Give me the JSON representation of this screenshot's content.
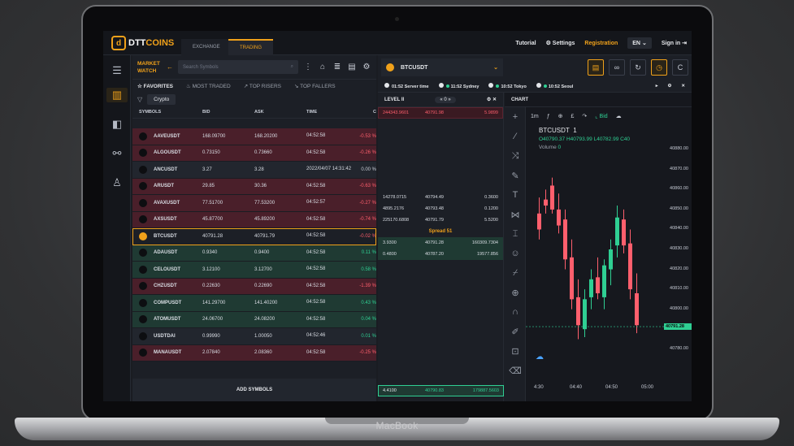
{
  "device": {
    "brand": "MacBook"
  },
  "header": {
    "logo": {
      "mark": "d",
      "name_bold": "DTT",
      "name_accent": "COINS"
    },
    "tabs": [
      {
        "label": "EXCHANGE"
      },
      {
        "label": "TRADING"
      }
    ],
    "active_tab": "TRADING",
    "links": {
      "tutorial": "Tutorial",
      "settings": "Settings",
      "registration": "Registration",
      "language": "EN",
      "signin": "Sign in"
    }
  },
  "market_watch": {
    "title": "MARKET WATCH",
    "search_placeholder": "Search Symbols",
    "filters": [
      "FAVORITES",
      "MOST TRADED",
      "TOP RISERS",
      "TOP FALLERS"
    ],
    "active_filter": "FAVORITES",
    "chip": "Crypto",
    "columns": [
      "SYMBOLS",
      "BID",
      "ASK",
      "TIME",
      "C"
    ],
    "rows": [
      {
        "symbol": "AAVEUSDT",
        "bid": "168.09700",
        "ask": "168.20200",
        "time": "04:52:58",
        "change": "-0.53 %",
        "trend": "dn"
      },
      {
        "symbol": "ALGOUSDT",
        "bid": "0.73150",
        "ask": "0.73660",
        "time": "04:52:58",
        "change": "-0.26 %",
        "trend": "dn"
      },
      {
        "symbol": "ANCUSDT",
        "bid": "3.27",
        "ask": "3.28",
        "time": "2022/04/07 14:31:42",
        "change": "0.00 %",
        "trend": "neutral"
      },
      {
        "symbol": "ARUSDT",
        "bid": "29.85",
        "ask": "30.36",
        "time": "04:52:58",
        "change": "-0.63 %",
        "trend": "dn"
      },
      {
        "symbol": "AVAXUSDT",
        "bid": "77.51700",
        "ask": "77.53200",
        "time": "04:52:57",
        "change": "-0.27 %",
        "trend": "dn"
      },
      {
        "symbol": "AXSUSDT",
        "bid": "45.87700",
        "ask": "45.89200",
        "time": "04:52:58",
        "change": "-0.74 %",
        "trend": "dn"
      },
      {
        "symbol": "BTCUSDT",
        "bid": "40791.28",
        "ask": "40791.79",
        "time": "04:52:58",
        "change": "-0.02 %",
        "trend": "sel"
      },
      {
        "symbol": "ADAUSDT",
        "bid": "0.9340",
        "ask": "0.9400",
        "time": "04:52:58",
        "change": "0.11 %",
        "trend": "up"
      },
      {
        "symbol": "CELOUSDT",
        "bid": "3.12100",
        "ask": "3.12700",
        "time": "04:52:58",
        "change": "0.58 %",
        "trend": "up"
      },
      {
        "symbol": "CHZUSDT",
        "bid": "0.22630",
        "ask": "0.22690",
        "time": "04:52:58",
        "change": "-1.39 %",
        "trend": "dn"
      },
      {
        "symbol": "COMPUSDT",
        "bid": "141.29700",
        "ask": "141.40200",
        "time": "04:52:58",
        "change": "0.43 %",
        "trend": "up"
      },
      {
        "symbol": "ATOMUSDT",
        "bid": "24.06700",
        "ask": "24.08200",
        "time": "04:52:58",
        "change": "0.04 %",
        "trend": "up"
      },
      {
        "symbol": "USDTDAI",
        "bid": "0.99990",
        "ask": "1.00050",
        "time": "04:52:46",
        "change": "0.01 %",
        "trend": "neutral"
      },
      {
        "symbol": "MANAUSDT",
        "bid": "2.07840",
        "ask": "2.08360",
        "time": "04:52:58",
        "change": "-0.25 %",
        "trend": "dn"
      }
    ],
    "add_symbols": "ADD SYMBOLS"
  },
  "instrument": {
    "symbol": "BTCUSDT"
  },
  "clocks": [
    {
      "time": "01:52",
      "label": "Server time"
    },
    {
      "time": "11:52",
      "label": "Sydney"
    },
    {
      "time": "10:52",
      "label": "Tokyo"
    },
    {
      "time": "10:52",
      "label": "Seoul"
    }
  ],
  "orderbook": {
    "title": "LEVEL II",
    "depth": "0",
    "top_ask": {
      "qty": "244343.9601",
      "price": "40791.98",
      "size": "5.9899"
    },
    "asks": [
      {
        "qty": "14278.0715",
        "price": "40794.49",
        "size": "0.3600"
      },
      {
        "qty": "4895.2176",
        "price": "40793.48",
        "size": "0.1200"
      },
      {
        "qty": "225170.6808",
        "price": "40791.79",
        "size": "5.5200"
      }
    ],
    "spread": "Spread 51",
    "bids": [
      {
        "qty": "3.9300",
        "price": "40791.28",
        "size": "160309.7304"
      },
      {
        "qty": "0.4800",
        "price": "40787.20",
        "size": "19577.856"
      }
    ],
    "last": {
      "qty": "4.4100",
      "price": "40790.83",
      "size": "179887.5603"
    }
  },
  "chart_panel": {
    "title": "CHART",
    "interval": "1m",
    "indicator": "Bid",
    "legend_symbol": "BTCUSDT",
    "legend_interval": "1",
    "ohlc": "O40790.37 H40793.99 L40782.99 C40",
    "volume_label": "Volume",
    "volume_value": "0"
  },
  "chart_data": {
    "type": "candlestick",
    "price_ticks": [
      "40880.00",
      "40870.00",
      "40860.00",
      "40850.00",
      "40840.00",
      "40830.00",
      "40820.00",
      "40810.00",
      "40800.00",
      "40791.28",
      "40780.00"
    ],
    "current_price": "40791.28",
    "time_ticks": [
      "4:30",
      "04:40",
      "04:50",
      "05:00"
    ],
    "ylim": [
      40775,
      40885
    ],
    "candles": [
      {
        "o": 40848,
        "h": 40856,
        "l": 40835,
        "c": 40840
      },
      {
        "o": 40855,
        "h": 40860,
        "l": 40848,
        "c": 40852
      },
      {
        "o": 40862,
        "h": 40866,
        "l": 40848,
        "c": 40850
      },
      {
        "o": 40850,
        "h": 40858,
        "l": 40838,
        "c": 40842
      },
      {
        "o": 40845,
        "h": 40850,
        "l": 40820,
        "c": 40825
      },
      {
        "o": 40826,
        "h": 40835,
        "l": 40800,
        "c": 40805
      },
      {
        "o": 40806,
        "h": 40815,
        "l": 40785,
        "c": 40792
      },
      {
        "o": 40790,
        "h": 40810,
        "l": 40786,
        "c": 40805
      },
      {
        "o": 40806,
        "h": 40820,
        "l": 40800,
        "c": 40815
      },
      {
        "o": 40816,
        "h": 40826,
        "l": 40805,
        "c": 40808
      },
      {
        "o": 40806,
        "h": 40825,
        "l": 40800,
        "c": 40822
      },
      {
        "o": 40820,
        "h": 40835,
        "l": 40812,
        "c": 40830
      },
      {
        "o": 40832,
        "h": 40852,
        "l": 40826,
        "c": 40846
      },
      {
        "o": 40845,
        "h": 40850,
        "l": 40828,
        "c": 40832
      },
      {
        "o": 40833,
        "h": 40840,
        "l": 40805,
        "c": 40810
      },
      {
        "o": 40808,
        "h": 40818,
        "l": 40788,
        "c": 40792
      }
    ]
  },
  "colors": {
    "accent": "#f0a11a",
    "up": "#2fcf93",
    "down": "#ff5f6d",
    "up_row": "#1f3a33",
    "down_row": "#4a1f2a"
  }
}
